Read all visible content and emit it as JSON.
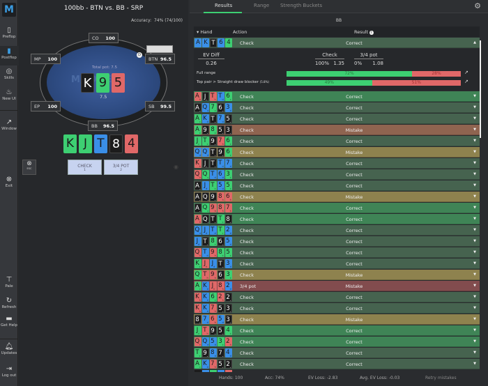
{
  "sidebar": {
    "logo": "M",
    "items": [
      {
        "label": "Preflop",
        "icon": "preflop-icon"
      },
      {
        "label": "Postflop",
        "icon": "postflop-icon"
      },
      {
        "label": "Skills",
        "icon": "target-icon"
      },
      {
        "label": "New UI",
        "icon": "flame-icon"
      },
      {
        "label": "Window",
        "icon": "external-window-icon"
      },
      {
        "label": "Exit",
        "icon": "close-circle-icon"
      },
      {
        "label": "Pale",
        "icon": "paint-roller-icon"
      },
      {
        "label": "Refresh",
        "icon": "refresh-icon"
      },
      {
        "label": "Get Help",
        "icon": "discord-icon"
      },
      {
        "label": "Updates",
        "icon": "bell-icon"
      },
      {
        "label": "Log out",
        "icon": "logout-icon"
      }
    ]
  },
  "game": {
    "title": "100bb - BTN vs. BB - SRP",
    "accuracy_label": "Accuracy:",
    "accuracy": "74% (74/100)",
    "total_pot": "Total pot: 7.5",
    "pot": "7.5",
    "watermark": "MODDER",
    "dealer": "D",
    "seats": {
      "co": {
        "name": "CO",
        "stack": "100"
      },
      "mp": {
        "name": "MP",
        "stack": "100"
      },
      "btn": {
        "name": "BTN",
        "stack": "96.5"
      },
      "ep": {
        "name": "EP",
        "stack": "100"
      },
      "sb": {
        "name": "SB",
        "stack": "99.5"
      },
      "bb": {
        "name": "BB",
        "stack": "96.5"
      }
    },
    "board": [
      {
        "rank": "K",
        "suit": "s"
      },
      {
        "rank": "9",
        "suit": "c"
      },
      {
        "rank": "5",
        "suit": "h"
      }
    ],
    "hole": [
      {
        "rank": "K",
        "suit": "c"
      },
      {
        "rank": "J",
        "suit": "c"
      },
      {
        "rank": "T",
        "suit": "d"
      },
      {
        "rank": "8",
        "suit": "s"
      },
      {
        "rank": "4",
        "suit": "h"
      }
    ],
    "esc_label": "ESC",
    "actions": [
      {
        "label": "CHECK",
        "key": "1"
      },
      {
        "label": "3/4 POT",
        "key": "2"
      }
    ]
  },
  "results": {
    "tabs": [
      "Results",
      "Range",
      "Strength Buckets"
    ],
    "player": "BB",
    "headers": {
      "hand": "Hand",
      "action": "Action",
      "result": "Result"
    },
    "expanded": {
      "cards": [
        {
          "rank": "A",
          "suit": "d"
        },
        {
          "rank": "K",
          "suit": "d"
        },
        {
          "rank": "T",
          "suit": "s"
        },
        {
          "rank": "6",
          "suit": "d"
        },
        {
          "rank": "4",
          "suit": "c"
        }
      ],
      "action": "Check",
      "result": "Correct",
      "ev_diff_label": "EV Diff",
      "ev_diff": "0.26",
      "options": [
        {
          "label": "Check",
          "freq": "100%",
          "ev": "1.35"
        },
        {
          "label": "3/4 pot",
          "freq": "0%",
          "ev": "1.08"
        }
      ],
      "bars": [
        {
          "label": "Full range",
          "note": "",
          "check": 72,
          "bet": 28,
          "check_label": "72%",
          "bet_label": "28%"
        },
        {
          "label": "Top pair > Straight draw blocker",
          "note": "(5.8%)",
          "check": 49,
          "bet": 51,
          "check_label": "49%",
          "bet_label": "51%"
        }
      ]
    },
    "colors": {
      "correct_best": "#3f8456",
      "correct": "#46634f",
      "mistake_minor": "#8e824e",
      "mistake": "#8f6450",
      "mistake_major": "#824c4e"
    },
    "rows": [
      {
        "hand": "AhJsThTd6c",
        "action": "Check",
        "result": "Correct",
        "level": "correct_best"
      },
      {
        "hand": "AsQd7c6s3d",
        "action": "Check",
        "result": "Correct",
        "level": "correct"
      },
      {
        "hand": "AcKdTs7d5s",
        "action": "Check",
        "result": "Correct",
        "level": "correct"
      },
      {
        "hand": "Ac9s8c5s3s",
        "action": "Check",
        "result": "Mistake",
        "level": "mistake"
      },
      {
        "hand": "JcTc9s7h6c",
        "action": "Check",
        "result": "Correct",
        "level": "correct"
      },
      {
        "hand": "QdQdTs9s6c",
        "action": "Check",
        "result": "Mistake",
        "level": "mistake_minor"
      },
      {
        "hand": "KhJsTsTd7d",
        "action": "Check",
        "result": "Correct",
        "level": "correct"
      },
      {
        "hand": "QhQcTd6d3c",
        "action": "Check",
        "result": "Correct",
        "level": "correct"
      },
      {
        "hand": "AsJdTc5d5c",
        "action": "Check",
        "result": "Correct",
        "level": "correct"
      },
      {
        "hand": "AsQs9s8h6h",
        "action": "Check",
        "result": "Mistake",
        "level": "mistake_minor"
      },
      {
        "hand": "AsQc9h8h7h",
        "action": "Check",
        "result": "Correct",
        "level": "correct_best"
      },
      {
        "hand": "AhQsTsTc8s",
        "action": "Check",
        "result": "Correct",
        "level": "correct_best"
      },
      {
        "hand": "QdJdTdTc2d",
        "action": "Check",
        "result": "Correct",
        "level": "correct"
      },
      {
        "hand": "JdTs8c6s5d",
        "action": "Check",
        "result": "Correct",
        "level": "correct"
      },
      {
        "hand": "QhTd9h8c5c",
        "action": "Check",
        "result": "Correct",
        "level": "correct"
      },
      {
        "hand": "KcJhJdTs3d",
        "action": "Check",
        "result": "Correct",
        "level": "correct"
      },
      {
        "hand": "QcTh9h6s3c",
        "action": "Check",
        "result": "Mistake",
        "level": "mistake_minor"
      },
      {
        "hand": "AcKdJh8h2d",
        "action": "3/4 pot",
        "result": "Mistake",
        "level": "mistake_major"
      },
      {
        "hand": "KhKd6c2h2s",
        "action": "Check",
        "result": "Correct",
        "level": "correct"
      },
      {
        "hand": "KhKd7h5s3s",
        "action": "Check",
        "result": "Correct",
        "level": "correct"
      },
      {
        "hand": "8s7d6h5d3s",
        "action": "Check",
        "result": "Mistake",
        "level": "mistake_minor"
      },
      {
        "hand": "JcTh9s5s4c",
        "action": "Check",
        "result": "Correct",
        "level": "correct_best"
      },
      {
        "hand": "QhQd5d3c2h",
        "action": "Check",
        "result": "Correct",
        "level": "correct_best"
      },
      {
        "hand": "Tc9s8d7s4d",
        "action": "Check",
        "result": "Correct",
        "level": "correct"
      },
      {
        "hand": "AcKd7h5s2s",
        "action": "Check",
        "result": "Correct",
        "level": "correct"
      }
    ],
    "footer": {
      "hands": "Hands: 100",
      "acc": "Acc: 74%",
      "ev_loss": "EV Loss: -2.83",
      "avg_ev_loss": "Avg. EV Loss: -0.03",
      "retry": "Retry mistakes"
    }
  }
}
